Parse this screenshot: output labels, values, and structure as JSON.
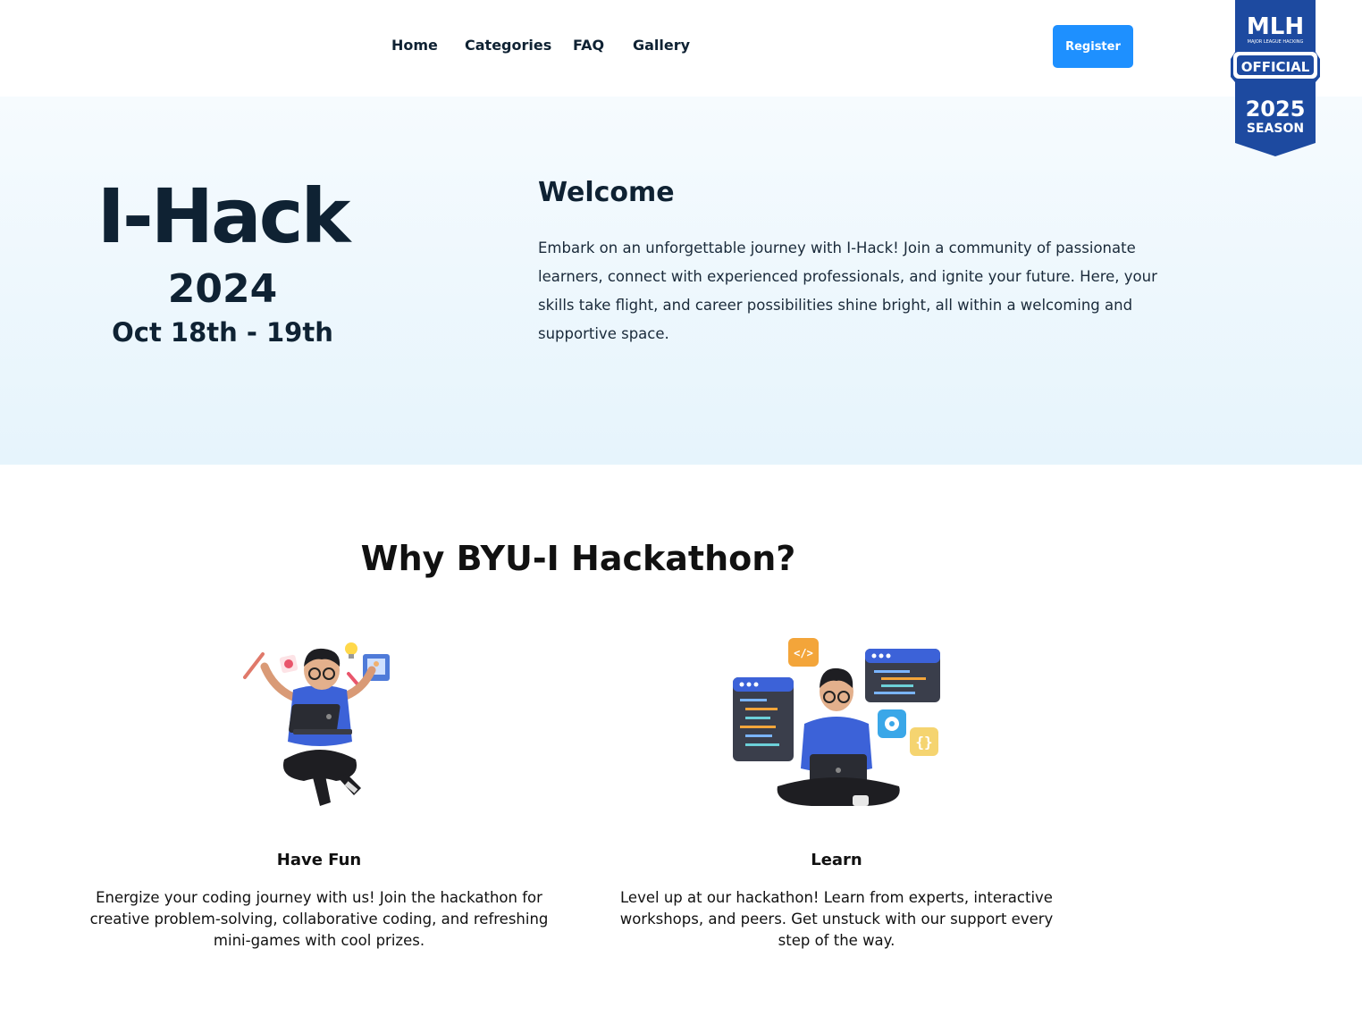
{
  "nav": {
    "links": [
      "Home",
      "Categories",
      "FAQ",
      "Gallery"
    ],
    "register_label": "Register"
  },
  "badge": {
    "top": "MLH",
    "tagline": "MAJOR LEAGUE HACKING",
    "official": "OFFICIAL",
    "year": "2025",
    "season": "SEASON",
    "color": "#1d4aa0"
  },
  "hero": {
    "title": "I-Hack",
    "year": "2024",
    "dates": "Oct 18th - 19th",
    "welcome_title": "Welcome",
    "welcome_text": "Embark on an unforgettable journey with I-Hack! Join a community of passionate learners, connect with experienced professionals, and ignite your future. Here, your skills take flight, and career possibilities shine bright, all within a welcoming and supportive space."
  },
  "why": {
    "title": "Why BYU-I Hackathon?",
    "features": [
      {
        "title": "Have Fun",
        "text": "Energize your coding journey with us! Join the hackathon for creative problem-solving, collaborative coding, and refreshing mini-games with cool prizes.",
        "icon": "creative-person-illustration"
      },
      {
        "title": "Learn",
        "text": "Level up at our hackathon! Learn from experts, interactive workshops, and peers. Get unstuck with our support every step of the way.",
        "icon": "coding-person-illustration"
      }
    ]
  },
  "colors": {
    "accent": "#1e90ff",
    "heading": "#0f2233"
  }
}
